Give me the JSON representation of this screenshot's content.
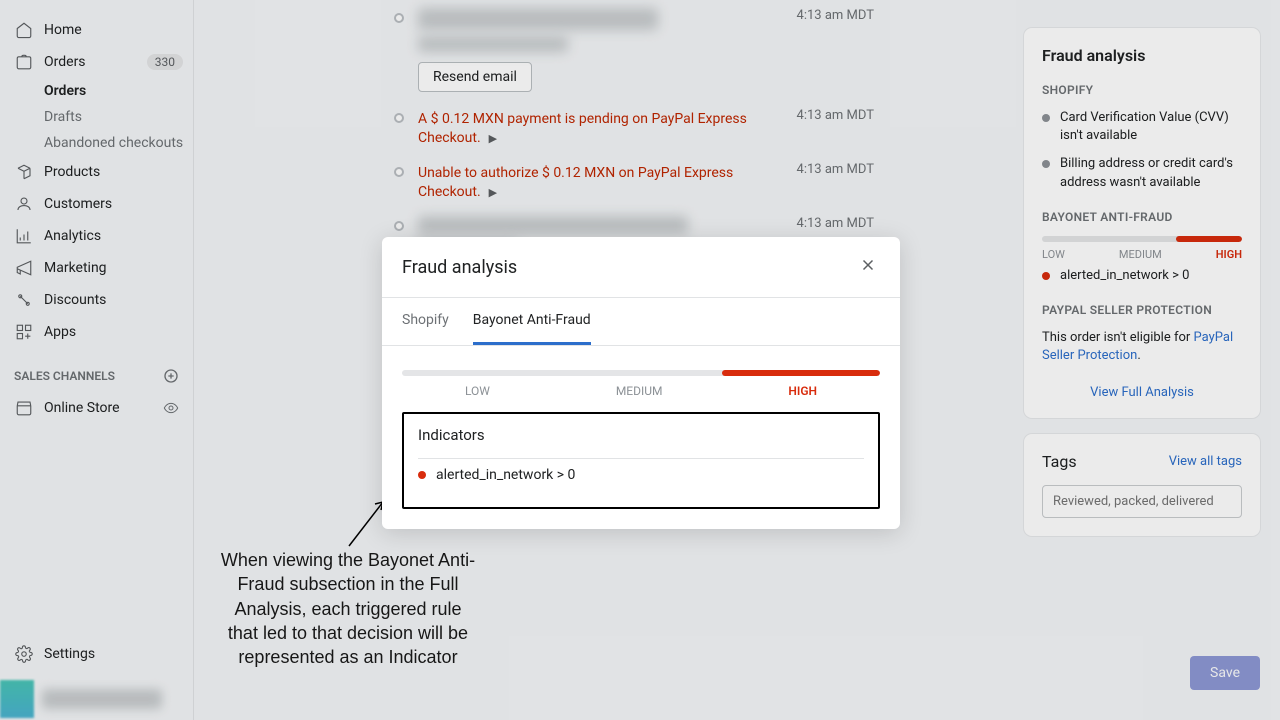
{
  "sidebar": {
    "nav": [
      {
        "label": "Home"
      },
      {
        "label": "Orders",
        "badge": "330"
      },
      {
        "label": "Products"
      },
      {
        "label": "Customers"
      },
      {
        "label": "Analytics"
      },
      {
        "label": "Marketing"
      },
      {
        "label": "Discounts"
      },
      {
        "label": "Apps"
      }
    ],
    "orders_sub": [
      {
        "label": "Orders"
      },
      {
        "label": "Drafts"
      },
      {
        "label": "Abandoned checkouts"
      }
    ],
    "channels_header": "SALES CHANNELS",
    "channels": [
      {
        "label": "Online Store"
      }
    ],
    "settings": "Settings"
  },
  "timeline": {
    "resend_label": "Resend email",
    "events": [
      {
        "text": "A $ 0.12 MXN payment is pending on PayPal Express Checkout.",
        "time": "4:13 am MDT"
      },
      {
        "text": "Unable to authorize $ 0.12 MXN on PayPal Express Checkout.",
        "time": "4:13 am MDT"
      }
    ],
    "time_a": "4:13 am MDT",
    "time_b": "4:13 am MDT"
  },
  "fraud_panel": {
    "title": "Fraud analysis",
    "shopify_label": "SHOPIFY",
    "shopify_items": [
      "Card Verification Value (CVV) isn't available",
      "Billing address or credit card's address wasn't available"
    ],
    "bayonet_label": "BAYONET ANTI-FRAUD",
    "risk_labels": {
      "low": "LOW",
      "medium": "MEDIUM",
      "high": "HIGH"
    },
    "bayonet_indicator": "alerted_in_network > 0",
    "paypal_label": "PAYPAL SELLER PROTECTION",
    "paypal_text_pre": "This order isn't eligible for ",
    "paypal_link": "PayPal Seller Protection",
    "paypal_text_post": ".",
    "view_full": "View Full Analysis"
  },
  "tags_panel": {
    "title": "Tags",
    "view_all": "View all tags",
    "placeholder": "Reviewed, packed, delivered"
  },
  "save_label": "Save",
  "annotation": "When viewing the Bayonet Anti-Fraud subsection in the Full Analysis, each triggered rule that led to that decision will be represented as an Indicator",
  "modal": {
    "title": "Fraud analysis",
    "tabs": [
      {
        "label": "Shopify"
      },
      {
        "label": "Bayonet Anti-Fraud"
      }
    ],
    "risk_labels": {
      "low": "LOW",
      "medium": "MEDIUM",
      "high": "HIGH"
    },
    "indicators_title": "Indicators",
    "indicator_item": "alerted_in_network > 0"
  }
}
